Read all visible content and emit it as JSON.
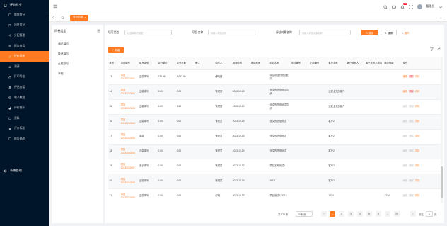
{
  "sidebar": {
    "group1_label": "评价作业",
    "items": [
      {
        "label": "题库登记",
        "icon": "clipboard-icon"
      },
      {
        "label": "项目登记",
        "icon": "flag-icon"
      },
      {
        "label": "分配管理",
        "icon": "share-icon"
      },
      {
        "label": "报告查看",
        "icon": "eye-icon"
      },
      {
        "label": "评价问卷",
        "icon": "edit-icon"
      },
      {
        "label": "测评",
        "icon": "chart-icon"
      },
      {
        "label": "打印导出",
        "icon": "printer-icon"
      },
      {
        "label": "评估查看",
        "icon": "user-icon"
      },
      {
        "label": "电子数据",
        "icon": "database-icon"
      },
      {
        "label": "评价统计",
        "icon": "pie-icon"
      },
      {
        "label": "资料",
        "icon": "folder-icon"
      },
      {
        "label": "评价标准",
        "icon": "star-icon"
      },
      {
        "label": "报告修改",
        "icon": "file-icon"
      }
    ],
    "group2_label": "系统管理"
  },
  "header": {
    "user_name": "管理员",
    "badge_count": "20"
  },
  "tabs": {
    "active_label": "评价问卷"
  },
  "tree": {
    "title": "问卷类型",
    "items": [
      "通识填写",
      "技评填写",
      "正能填写",
      "事能"
    ]
  },
  "search": {
    "label1": "填写类型",
    "placeholder1": "请选择填写类型",
    "label2": "项目名称",
    "placeholder2": "请输入项目名称",
    "label3": "评估对象名称",
    "placeholder3": "请输入评估对象名称",
    "search_btn": "搜索",
    "reset_btn": "重置",
    "expand": "展开"
  },
  "toolbar": {
    "add_btn": "新增"
  },
  "table": {
    "columns": [
      "序号",
      "项目编号",
      "填写类型",
      "评分单价",
      "评分总额",
      "备注",
      "填写人",
      "期间时间",
      "地域时间",
      "项目名称",
      "项目编号",
      "正能编号",
      "客户名称",
      "客户联系人",
      "客户联系人电话",
      "服务等级",
      "操作"
    ],
    "rows": [
      {
        "no": "13",
        "code": "项目20231210001",
        "type": "正能填写",
        "price": "134.95",
        "total": "1,043.00",
        "note": "",
        "person": "傅晓超",
        "date": "",
        "region": "",
        "project": "评估项目的测试批次",
        "pno": "",
        "zno": "",
        "client": "",
        "contact": "",
        "phone": "",
        "level": "",
        "actions": [
          "编辑",
          "删除",
          "详情"
        ]
      },
      {
        "no": "14",
        "code": "项目20231210002",
        "type": "正能填写",
        "price": "0.00",
        "total": "0.00",
        "note": "",
        "person": "管理员",
        "date": "2023-12-10",
        "region": "",
        "project": "全文的总结测试同步",
        "pno": "",
        "zno": "",
        "client": "过度全文的客户",
        "contact": "",
        "phone": "",
        "level": "",
        "actions": [
          "编辑",
          "删除",
          "详情"
        ]
      },
      {
        "no": "15",
        "code": "项目20231210003",
        "type": "正能填写",
        "price": "0.00",
        "total": "0.00",
        "note": "",
        "person": "管理员",
        "date": "2023-12-10",
        "region": "",
        "project": "全文的总结测试同步",
        "pno": "",
        "zno": "",
        "client": "过度全文的客户",
        "contact": "",
        "phone": "",
        "level": "",
        "actions": [
          "编辑",
          "删除",
          "详情"
        ]
      },
      {
        "no": "16",
        "code": "项目20231210004",
        "type": "正能填写",
        "price": "0.00",
        "total": "0.00",
        "note": "",
        "person": "管理员",
        "date": "2023-12-10",
        "region": "",
        "project": "全文的总结测试",
        "pno": "",
        "zno": "",
        "client": "客户2",
        "contact": "",
        "phone": "",
        "level": "",
        "actions": [
          "编辑",
          "删除",
          "详情"
        ]
      },
      {
        "no": "17",
        "code": "项目20231210005",
        "type": "事能",
        "price": "0.00",
        "total": "0.00",
        "note": "",
        "person": "管理员",
        "date": "2023-12-10",
        "region": "",
        "project": "全文的总结测试",
        "pno": "",
        "zno": "",
        "client": "客户2",
        "contact": "",
        "phone": "",
        "level": "",
        "actions": [
          "编辑",
          "删除",
          "详情"
        ]
      },
      {
        "no": "18",
        "code": "项目20231210006",
        "type": "正能填写",
        "price": "0.00",
        "total": "0.00",
        "note": "",
        "person": "管理员",
        "date": "2023-12-10",
        "region": "",
        "project": "全文的总结测试",
        "pno": "",
        "zno": "",
        "client": "客户2",
        "contact": "",
        "phone": "",
        "level": "",
        "actions": [
          "编辑",
          "删除",
          "详情"
        ]
      },
      {
        "no": "19",
        "code": "项目20231210007",
        "type": "通识填写",
        "price": "0.00",
        "total": "0.00",
        "note": "",
        "person": "管理员",
        "date": "2023-12-12",
        "region": "",
        "project": "项目名称测试1",
        "pno": "",
        "zno": "",
        "client": "客户2",
        "contact": "",
        "phone": "",
        "level": "",
        "actions": [
          "编辑",
          "删除",
          "详情"
        ]
      },
      {
        "no": "20",
        "code": "项目20231210008",
        "type": "正能填写",
        "price": "0.00",
        "total": "0.00",
        "note": "",
        "person": "管理员",
        "date": "2023-12-13",
        "region": "",
        "project": "11111",
        "pno": "",
        "zno": "",
        "client": "客户2",
        "contact": "",
        "phone": "",
        "level": "",
        "actions": [
          "编辑",
          "删除",
          "详情"
        ]
      },
      {
        "no": "21",
        "code": "项目20231210009",
        "type": "正能填写",
        "price": "0.00",
        "total": "0.00",
        "note": "",
        "person": "彭明",
        "date": "2023-12-13",
        "region": "",
        "project": "项目测试123213",
        "pno": "",
        "zno": "",
        "client": "1234",
        "contact": "",
        "phone": "",
        "level": "1234",
        "actions": [
          "编辑",
          "删除",
          "详情"
        ]
      }
    ]
  },
  "pager": {
    "total": "共 575 条",
    "size": "20条/页",
    "pages": [
      "1",
      "2",
      "3",
      "4",
      "5",
      "6",
      "...",
      "29"
    ],
    "goto_label": "前往",
    "goto_value": "1",
    "page_suffix": "页"
  }
}
